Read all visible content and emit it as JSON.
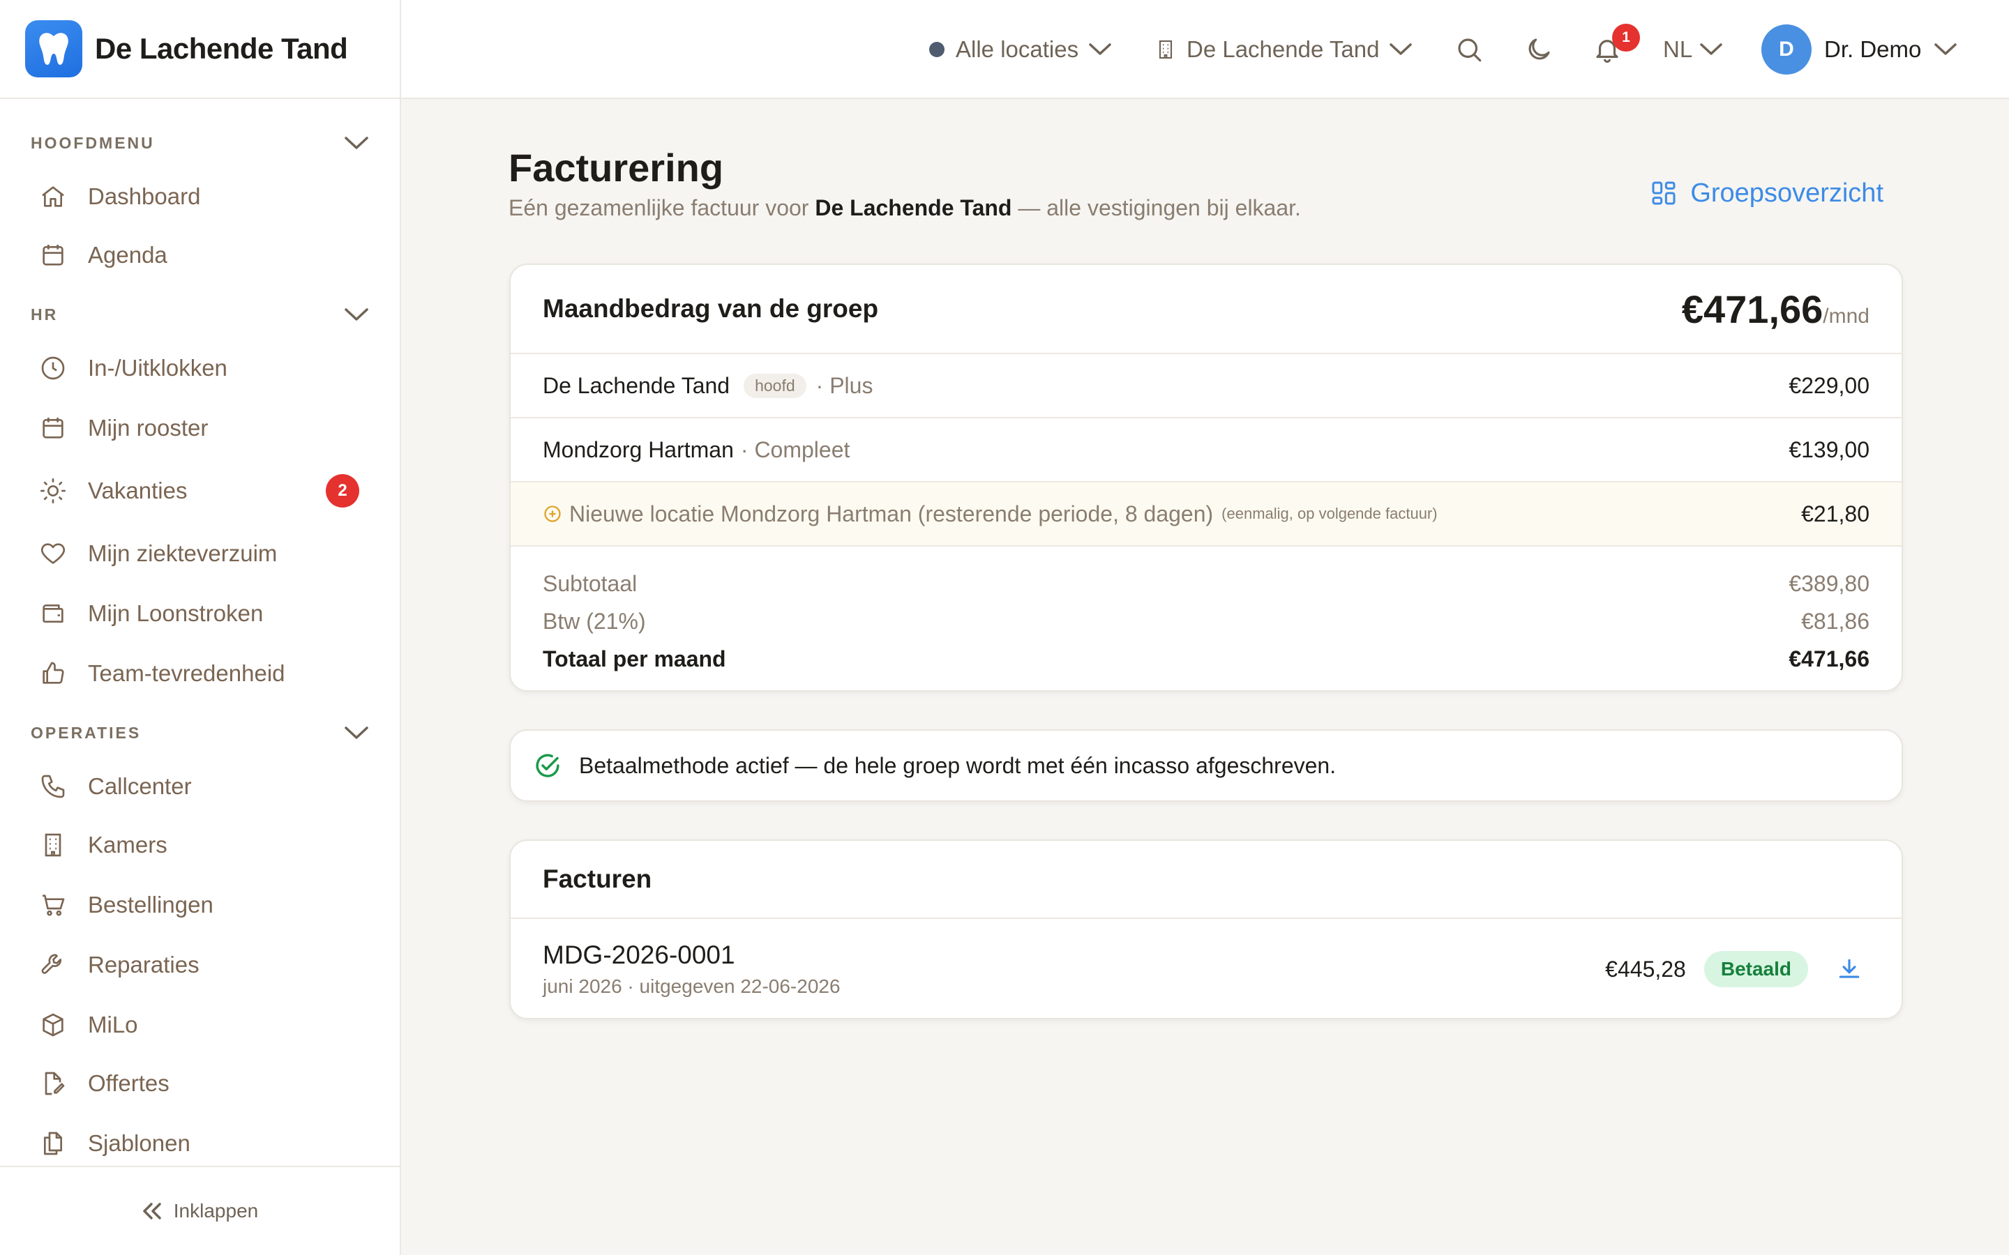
{
  "app": {
    "name": "De Lachende Tand"
  },
  "topbar": {
    "location_filter": "Alle locaties",
    "practice": "De Lachende Tand",
    "notification_count": "1",
    "language": "NL",
    "user_initial": "D",
    "user_name": "Dr. Demo"
  },
  "sidebar": {
    "sections": {
      "main": "HOOFDMENU",
      "hr": "HR",
      "ops": "OPERATIES"
    },
    "items": {
      "dashboard": "Dashboard",
      "agenda": "Agenda",
      "clock": "In-/Uitklokken",
      "rooster": "Mijn rooster",
      "vakanties": "Vakanties",
      "vakanties_badge": "2",
      "ziekte": "Mijn ziekteverzuim",
      "loonstroken": "Mijn Loonstroken",
      "tevredenheid": "Team-tevredenheid",
      "callcenter": "Callcenter",
      "kamers": "Kamers",
      "bestellingen": "Bestellingen",
      "reparaties": "Reparaties",
      "milo": "MiLo",
      "offertes": "Offertes",
      "sjablonen": "Sjablonen"
    },
    "collapse_label": "Inklappen"
  },
  "page": {
    "title": "Facturering",
    "subtitle_pre": "Eén gezamenlijke factuur voor ",
    "subtitle_bold": "De Lachende Tand",
    "subtitle_post": " — alle vestigingen bij elkaar.",
    "group_overview": "Groepsoverzicht"
  },
  "summary": {
    "title": "Maandbedrag van de groep",
    "total": "€471,66",
    "per": "/mnd",
    "lines": {
      "l1_name": "De Lachende Tand",
      "l1_tag": "hoofd",
      "l1_plan": "· Plus",
      "l1_amount": "€229,00",
      "l2_name": "Mondzorg Hartman",
      "l2_plan": "· Compleet",
      "l2_amount": "€139,00",
      "l3_name": "Nieuwe locatie Mondzorg Hartman (resterende periode, 8 dagen)",
      "l3_note": "(eenmalig, op volgende factuur)",
      "l3_amount": "€21,80"
    },
    "subtotal_label": "Subtotaal",
    "subtotal": "€389,80",
    "vat_label": "Btw (21%)",
    "vat": "€81,86",
    "total_label": "Totaal per maand",
    "total_value": "€471,66"
  },
  "payment": {
    "text": "Betaalmethode actief — de hele groep wordt met één incasso afgeschreven."
  },
  "invoices": {
    "title": "Facturen",
    "rows": [
      {
        "number": "MDG-2026-0001",
        "meta": "juni 2026 · uitgegeven 22-06-2026",
        "amount": "€445,28",
        "status": "Betaald"
      }
    ]
  },
  "colors": {
    "accent": "#3d8be6",
    "badge": "#e5322f",
    "paid_bg": "#d8f5e2",
    "paid_text": "#16803c",
    "highlight_row": "#fdfbf1"
  }
}
